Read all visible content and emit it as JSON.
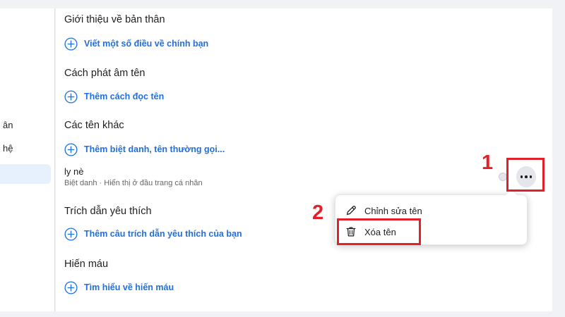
{
  "left_nav": {
    "item_1_partial": "ân",
    "item_2_partial": "hệ"
  },
  "sections": {
    "about": {
      "title": "Giới thiệu về bản thân",
      "add_label": "Viết một số điều về chính bạn"
    },
    "pronunciation": {
      "title": "Cách phát âm tên",
      "add_label": "Thêm cách đọc tên"
    },
    "other_names": {
      "title": "Các tên khác",
      "add_label": "Thêm biệt danh, tên thường gọi...",
      "entry": {
        "name": "ly nè",
        "subtitle": "Biệt danh · Hiển thị ở đầu trang cá nhân"
      }
    },
    "favorite_quotes": {
      "title": "Trích dẫn yêu thích",
      "add_label": "Thêm câu trích dẫn yêu thích của bạn"
    },
    "blood_donation": {
      "title": "Hiến máu",
      "add_label": "Tìm hiểu về hiến máu"
    }
  },
  "context_menu": {
    "edit_label": "Chỉnh sửa tên",
    "delete_label": "Xóa tên"
  },
  "annotations": {
    "step_1": "1",
    "step_2": "2"
  },
  "colors": {
    "link_blue": "#216fdb",
    "annotation_red": "#e0202a",
    "text_dark": "#1c1e21",
    "text_gray": "#65676b"
  }
}
